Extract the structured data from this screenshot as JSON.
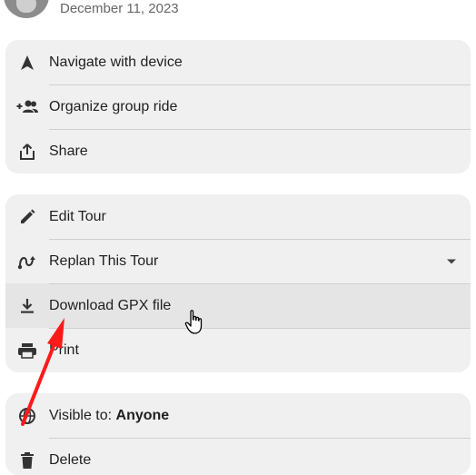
{
  "header": {
    "date": "December 11, 2023"
  },
  "menu_group_1": {
    "items": [
      {
        "label": "Navigate with device",
        "icon": "navigation-arrow-icon"
      },
      {
        "label": "Organize group ride",
        "icon": "group-add-icon"
      },
      {
        "label": "Share",
        "icon": "share-icon"
      }
    ]
  },
  "menu_group_2": {
    "items": [
      {
        "label": "Edit Tour",
        "icon": "pencil-icon"
      },
      {
        "label": "Replan This Tour",
        "icon": "route-icon"
      },
      {
        "label": "Download GPX file",
        "icon": "download-icon"
      },
      {
        "label": "Print",
        "icon": "printer-icon"
      }
    ]
  },
  "menu_group_3": {
    "visibility_prefix": "Visible to: ",
    "visibility_value": "Anyone",
    "delete_label": "Delete"
  },
  "colors": {
    "card_background": "#f0f0f0",
    "hover_background": "#e5e5e5",
    "annotation_arrow": "#ff1a1a"
  }
}
